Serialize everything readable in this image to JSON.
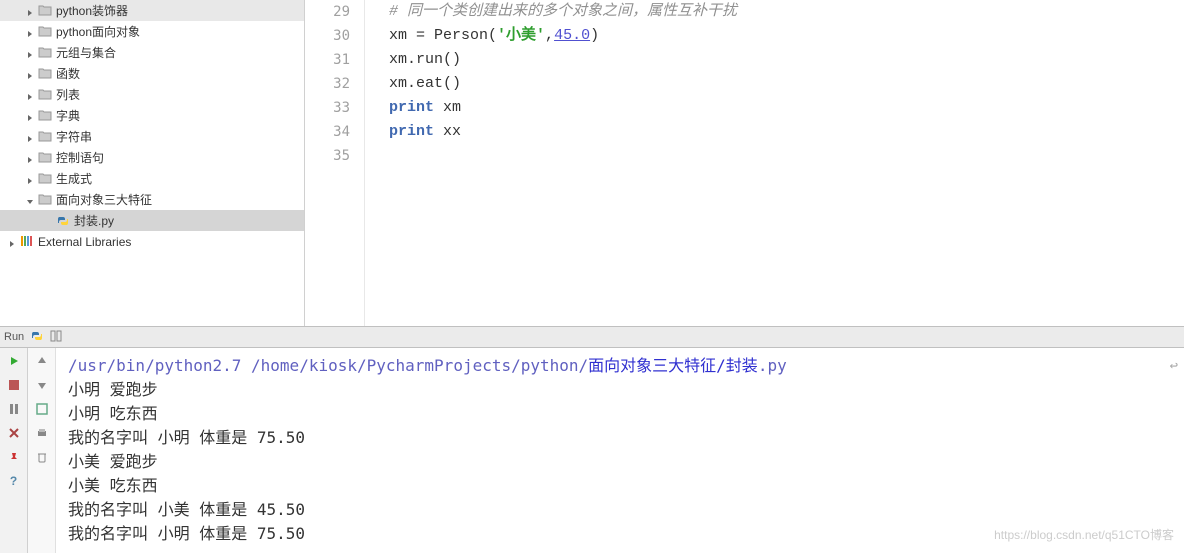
{
  "sidebar": {
    "items": [
      {
        "label": "python装饰器",
        "indent": 1,
        "type": "folder",
        "expand": "right"
      },
      {
        "label": "python面向对象",
        "indent": 1,
        "type": "folder",
        "expand": "right"
      },
      {
        "label": "元组与集合",
        "indent": 1,
        "type": "folder",
        "expand": "right"
      },
      {
        "label": "函数",
        "indent": 1,
        "type": "folder",
        "expand": "right"
      },
      {
        "label": "列表",
        "indent": 1,
        "type": "folder",
        "expand": "right"
      },
      {
        "label": "字典",
        "indent": 1,
        "type": "folder",
        "expand": "right"
      },
      {
        "label": "字符串",
        "indent": 1,
        "type": "folder",
        "expand": "right"
      },
      {
        "label": "控制语句",
        "indent": 1,
        "type": "folder",
        "expand": "right"
      },
      {
        "label": "生成式",
        "indent": 1,
        "type": "folder",
        "expand": "right"
      },
      {
        "label": "面向对象三大特征",
        "indent": 1,
        "type": "folder",
        "expand": "down"
      },
      {
        "label": "封装.py",
        "indent": 2,
        "type": "py",
        "selected": true
      },
      {
        "label": "External Libraries",
        "indent": 0,
        "type": "lib",
        "expand": "right"
      }
    ]
  },
  "editor": {
    "lines": [
      {
        "num": "29",
        "segments": [
          {
            "text": "# 同一个类创建出来的多个对象之间，属性互补干扰",
            "cls": "comment"
          }
        ]
      },
      {
        "num": "30",
        "segments": [
          {
            "text": "xm = Person(",
            "cls": ""
          },
          {
            "text": "'小美'",
            "cls": "string"
          },
          {
            "text": ",",
            "cls": ""
          },
          {
            "text": "45.0",
            "cls": "number"
          },
          {
            "text": ")",
            "cls": ""
          }
        ]
      },
      {
        "num": "31",
        "segments": [
          {
            "text": "xm.run()",
            "cls": ""
          }
        ]
      },
      {
        "num": "32",
        "segments": [
          {
            "text": "xm.eat()",
            "cls": ""
          }
        ]
      },
      {
        "num": "33",
        "segments": [
          {
            "text": "print",
            "cls": "keyword"
          },
          {
            "text": " xm",
            "cls": ""
          }
        ]
      },
      {
        "num": "34",
        "segments": [
          {
            "text": "print",
            "cls": "keyword"
          },
          {
            "text": " xx",
            "cls": ""
          }
        ]
      },
      {
        "num": "35",
        "segments": []
      }
    ]
  },
  "runbar": {
    "label": "Run"
  },
  "console": {
    "cmd_prefix": "/usr/bin/python2.7 /home/kiosk/PycharmProjects/python/",
    "cmd_cn": "面向对象三大特征/封装",
    "cmd_suffix": ".py",
    "lines": [
      "小明 爱跑步",
      "小明 吃东西",
      "我的名字叫 小明 体重是 75.50",
      "小美 爱跑步",
      "小美 吃东西",
      "我的名字叫 小美 体重是 45.50",
      "我的名字叫 小明 体重是 75.50"
    ],
    "watermark": "https://blog.csdn.net/q51CTO博客"
  }
}
